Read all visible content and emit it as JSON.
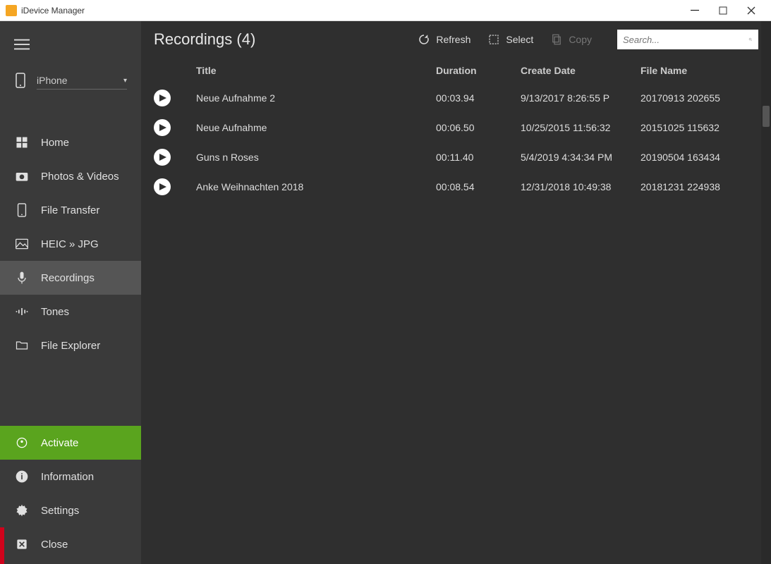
{
  "window": {
    "title": "iDevice Manager"
  },
  "sidebar": {
    "device": "iPhone",
    "nav": [
      {
        "label": "Home"
      },
      {
        "label": "Photos & Videos"
      },
      {
        "label": "File Transfer"
      },
      {
        "label": "HEIC » JPG"
      },
      {
        "label": "Recordings"
      },
      {
        "label": "Tones"
      },
      {
        "label": "File Explorer"
      }
    ],
    "bottom": [
      {
        "label": "Activate"
      },
      {
        "label": "Information"
      },
      {
        "label": "Settings"
      },
      {
        "label": "Close"
      }
    ]
  },
  "toolbar": {
    "title": "Recordings (4)",
    "refresh": "Refresh",
    "select": "Select",
    "copy": "Copy"
  },
  "search": {
    "placeholder": "Search..."
  },
  "columns": {
    "title": "Title",
    "duration": "Duration",
    "create": "Create Date",
    "file": "File Name"
  },
  "rows": [
    {
      "title": "Neue Aufnahme 2",
      "duration": "00:03.94",
      "create": "9/13/2017 8:26:55 P",
      "file": "20170913 202655"
    },
    {
      "title": "Neue Aufnahme",
      "duration": "00:06.50",
      "create": "10/25/2015 11:56:32",
      "file": "20151025 115632"
    },
    {
      "title": "Guns n Roses",
      "duration": "00:11.40",
      "create": "5/4/2019 4:34:34 PM",
      "file": "20190504 163434"
    },
    {
      "title": "Anke Weihnachten 2018",
      "duration": "00:08.54",
      "create": "12/31/2018 10:49:38",
      "file": "20181231 224938"
    }
  ]
}
